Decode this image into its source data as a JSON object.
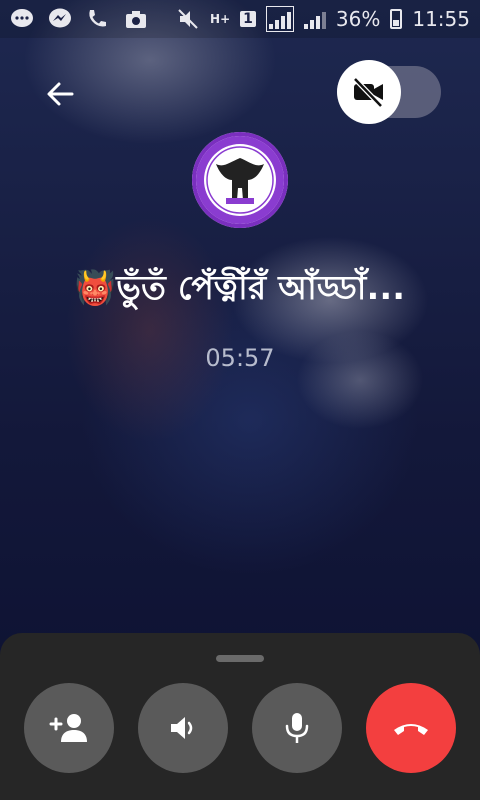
{
  "status_bar": {
    "network_type": "H+",
    "sim_slot": "1",
    "battery_percent": "36%",
    "time": "11:55"
  },
  "call": {
    "contact_name": "👹ভুঁতঁ পেঁত্নীঁরঁ আঁড্ডাঁ...",
    "duration": "05:57",
    "video_enabled": false
  },
  "controls": [
    {
      "name": "add-person",
      "icon": "add-person-icon"
    },
    {
      "name": "speaker",
      "icon": "speaker-icon"
    },
    {
      "name": "microphone",
      "icon": "microphone-icon"
    },
    {
      "name": "end-call",
      "icon": "end-call-icon",
      "color": "#f33f3f"
    }
  ],
  "colors": {
    "sheet": "#262626",
    "control": "#5a5a5a",
    "end_call": "#f33f3f",
    "avatar_ring": "#7a2fbf"
  }
}
